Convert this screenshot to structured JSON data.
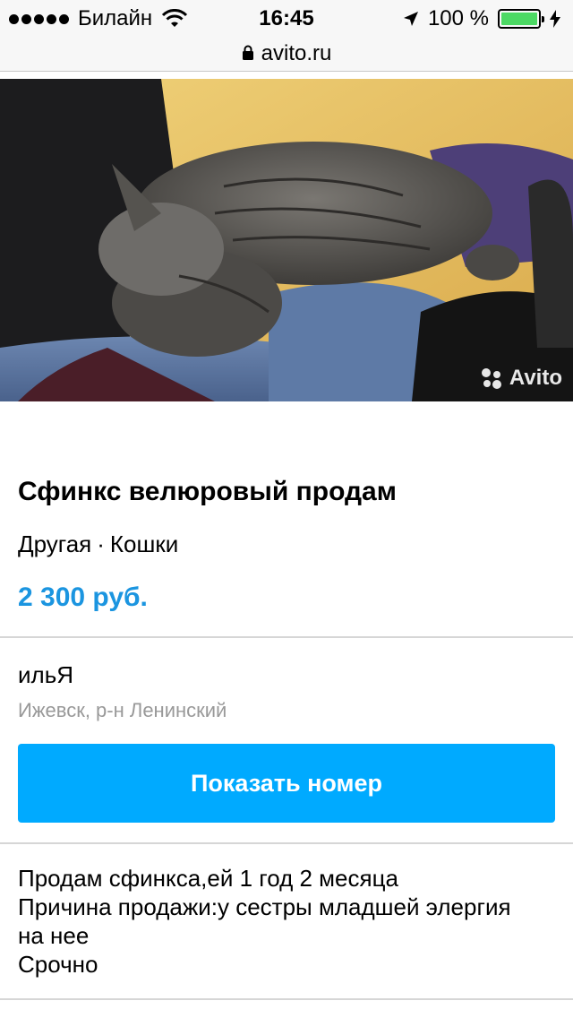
{
  "status_bar": {
    "carrier": "Билайн",
    "time": "16:45",
    "battery": "100 %"
  },
  "browser": {
    "url": "avito.ru"
  },
  "photo": {
    "watermark": "Avito"
  },
  "listing": {
    "title": "Сфинкс велюровый продам",
    "breed": "Другая",
    "separator": "·",
    "category": "Кошки",
    "price": "2 300 руб."
  },
  "seller": {
    "name": "ильЯ",
    "location": "Ижевск, р-н Ленинский",
    "show_number_label": "Показать номер"
  },
  "description": {
    "lines": [
      "Продам сфинкса,ей 1 год 2 месяца",
      "Причина продажи:у сестры младшей элергия",
      "на нее",
      "Срочно"
    ]
  },
  "colors": {
    "price": "#1b95e0",
    "button": "#00aaff",
    "battery": "#4cd964"
  }
}
